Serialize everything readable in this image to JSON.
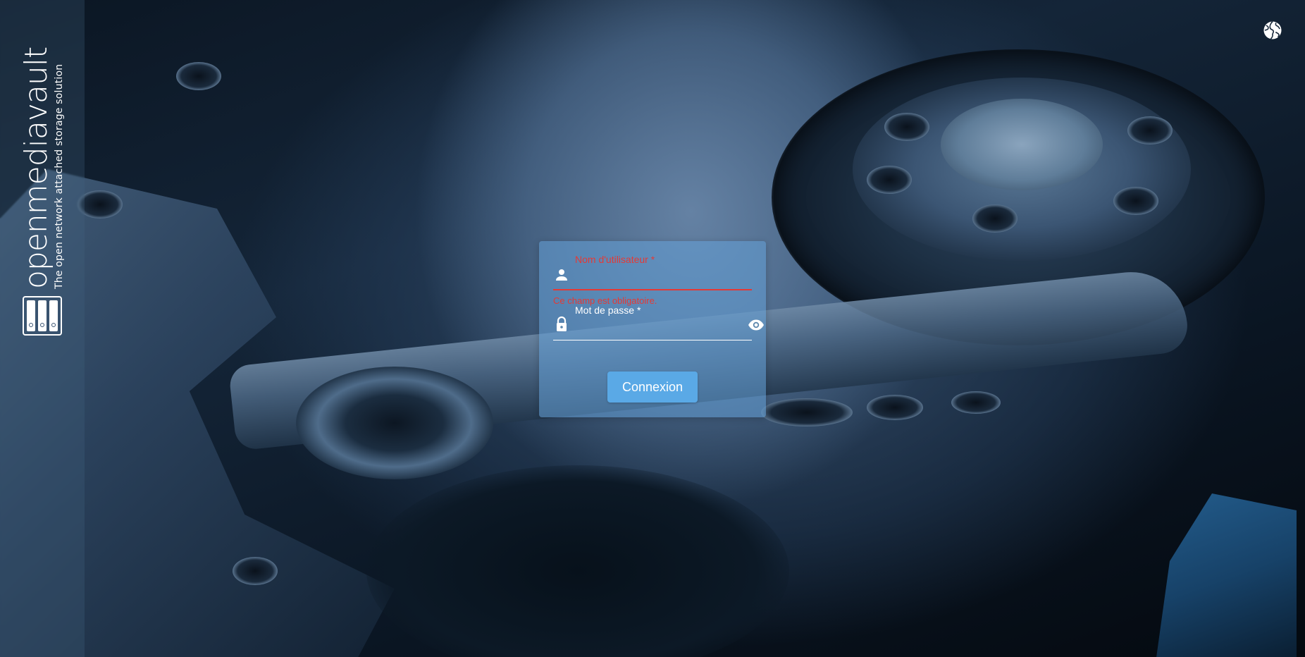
{
  "brand": {
    "name": "openmediavault",
    "tagline": "The open network attached storage solution",
    "logo_icon": "nas-drive-bays-icon"
  },
  "header": {
    "language_icon": "globe-icon"
  },
  "login": {
    "username": {
      "label": "Nom d'utilisateur *",
      "value": "",
      "icon": "person-icon",
      "error": "Ce champ est obligatoire."
    },
    "password": {
      "label": "Mot de passe *",
      "value": "",
      "icon": "lock-icon",
      "toggle_icon": "eye-icon"
    },
    "submit_label": "Connexion"
  },
  "colors": {
    "accent": "#5aa9e6",
    "error": "#e53935",
    "card": "#64a0d7"
  }
}
